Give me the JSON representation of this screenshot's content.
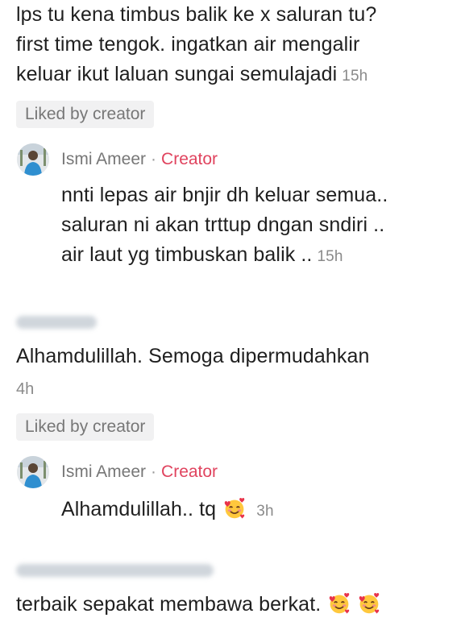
{
  "comments": [
    {
      "lines": [
        "lps tu kena timbus balik ke x saluran tu?",
        "first time tengok. ingatkan air mengalir",
        "keluar ikut laluan sungai semulajadi"
      ],
      "time": "15h",
      "badge": "Liked by creator"
    },
    {
      "author": "Ismi Ameer",
      "dot": "·",
      "role": "Creator",
      "lines": [
        "nnti lepas air bnjir dh keluar semua..",
        "saluran ni akan trttup dngan sndiri ..",
        "air laut yg timbuskan balik .."
      ],
      "time": "15h"
    },
    {
      "author_blurred": "Maznamuhd",
      "lines": [
        "Alhamdulillah. Semoga dipermudahkan"
      ],
      "time": "4h",
      "badge": "Liked by creator"
    },
    {
      "author": "Ismi Ameer",
      "dot": "·",
      "role": "Creator",
      "lines": [
        "Alhamdulillah.. tq"
      ],
      "emoji": "smiling-face-with-hearts",
      "time": "3h"
    },
    {
      "author_blurred": "user5468854445713",
      "lines": [
        "terbaik sepakat membawa berkat."
      ],
      "emoji": "smiling-face-with-hearts"
    }
  ],
  "colors": {
    "creator": "#e0435e",
    "muted": "#8a8a8a",
    "badge_bg": "#f1f1f2"
  }
}
